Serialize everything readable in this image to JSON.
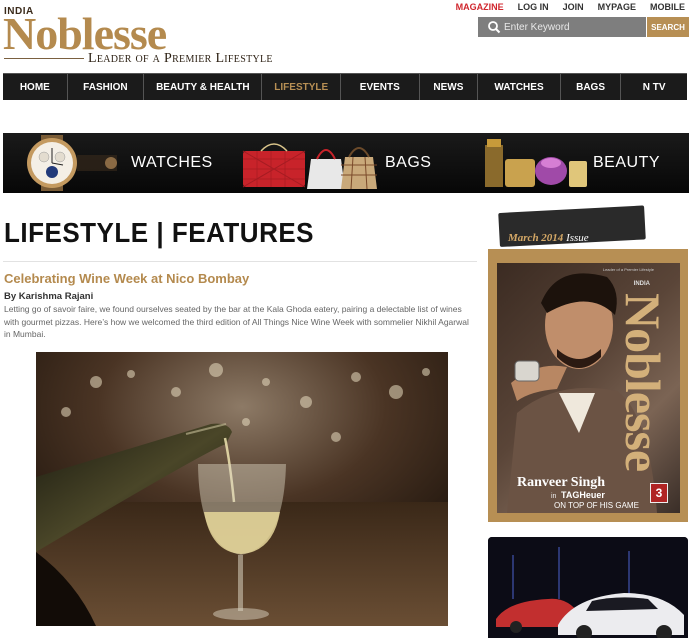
{
  "brand": {
    "country": "INDIA",
    "name": "Noblesse",
    "tagline": "Leader of a Premier Lifestyle"
  },
  "toplinks": [
    "MAGAZINE",
    "LOG IN",
    "JOIN",
    "MYPAGE",
    "MOBILE"
  ],
  "search": {
    "placeholder": "Enter Keyword",
    "button": "SEARCH"
  },
  "nav": [
    "HOME",
    "FASHION",
    "BEAUTY & HEALTH",
    "LIFESTYLE",
    "EVENTS",
    "NEWS",
    "WATCHES",
    "BAGS",
    "N TV"
  ],
  "nav_active": "LIFESTYLE",
  "banner": {
    "watches": "WATCHES",
    "bags": "BAGS",
    "beauty": "BEAUTY"
  },
  "page": {
    "heading": "LIFESTYLE | FEATURES"
  },
  "article": {
    "title": "Celebrating Wine Week at Nico Bombay",
    "byline": "By Karishma Rajani",
    "excerpt": "Letting go of savoir faire, we found ourselves seated by the bar at the Kala Ghoda eatery, pairing a delectable list of wines with gourmet pizzas. Here’s how we welcomed the third edition of All Things Nice Wine Week with sommelier Nikhil Agarwal in Mumbai."
  },
  "issue": {
    "month_year": "March 2014",
    "label": "Issue",
    "cover_country": "INDIA",
    "cover_small": "Leader of a Premier Lifestyle",
    "cover_title": "Noblesse",
    "cover_name": "Ranveer Singh",
    "cover_in": "in",
    "cover_brand": "TAGHeuer",
    "cover_tagline": "ON TOP OF HIS GAME",
    "cover_number": "3"
  },
  "colors": {
    "accent": "#b78f54",
    "nav_bg": "#1b1b1b",
    "highlight": "#d0262d"
  }
}
